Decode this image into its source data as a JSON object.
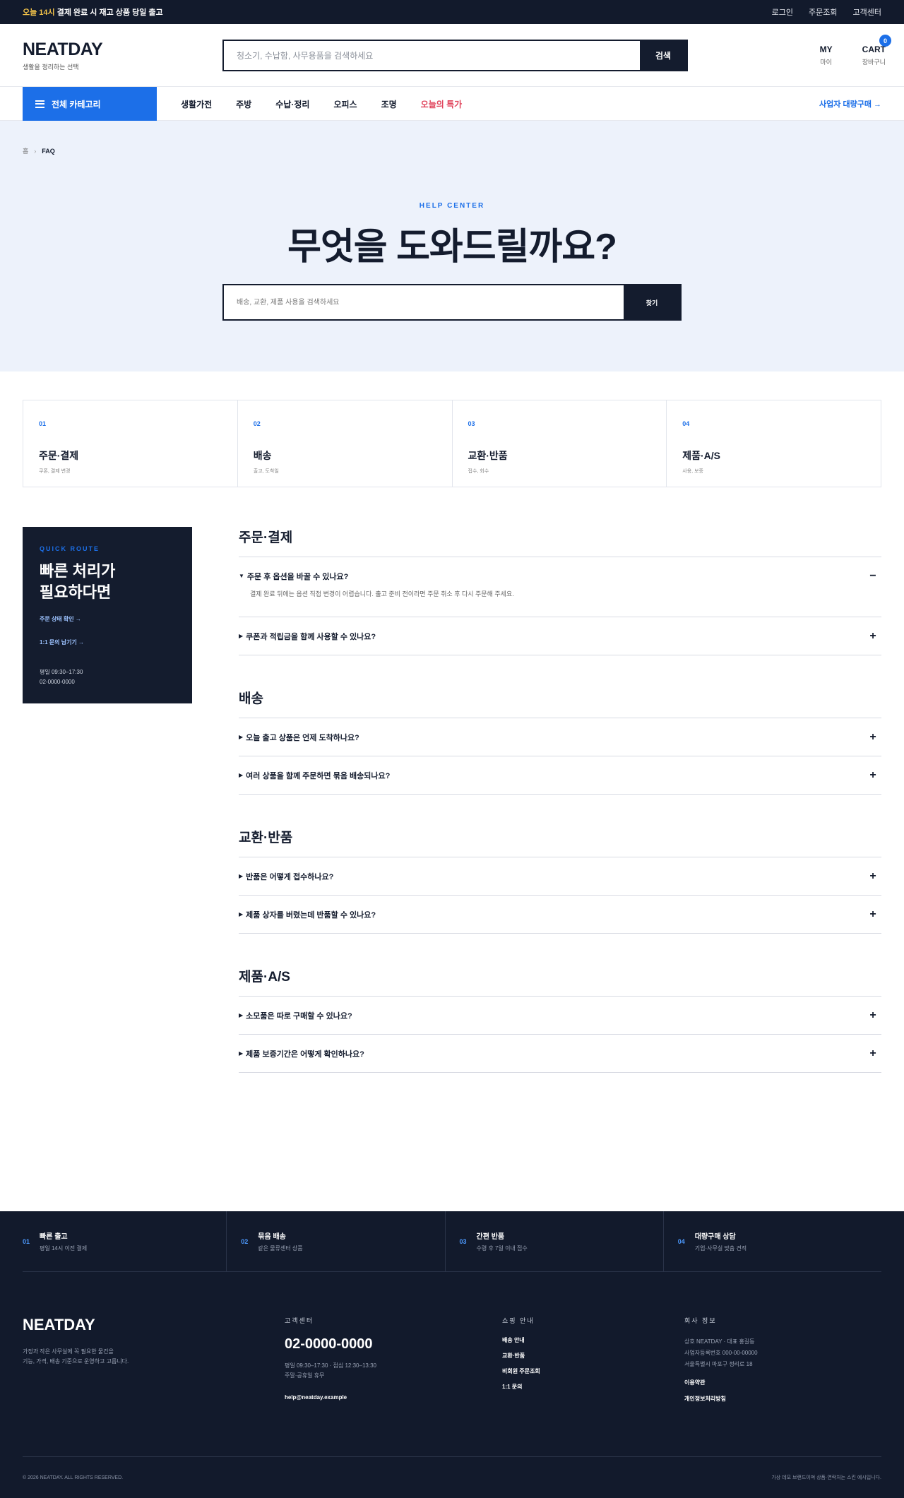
{
  "topbar": {
    "highlight": "오늘 14시",
    "notice": " 결제 완료 시 재고 상품 당일 출고",
    "links": [
      "로그인",
      "주문조회",
      "고객센터"
    ]
  },
  "header": {
    "logo": "NEATDAY",
    "tagline": "생활을 정리하는 선택",
    "search_placeholder": "청소기, 수납함, 사무용품을 검색하세요",
    "search_button": "검색",
    "my_label": "MY",
    "my_sub": "마이",
    "cart_label": "CART",
    "cart_sub": "장바구니",
    "cart_count": "0"
  },
  "nav": {
    "category_button": "전체 카테고리",
    "items": [
      "생활가전",
      "주방",
      "수납·정리",
      "오피스",
      "조명"
    ],
    "sale_item": "오늘의 특가",
    "bulk_link": "사업자 대량구매 →"
  },
  "breadcrumb": {
    "home": "홈",
    "sep": "›",
    "current": "FAQ"
  },
  "hero": {
    "eyebrow": "HELP CENTER",
    "title": "무엇을 도와드릴까요?",
    "search_placeholder": "배송, 교환, 제품 사용을 검색하세요",
    "search_button": "찾기"
  },
  "categories": [
    {
      "num": "01",
      "title": "주문·결제",
      "sub": "쿠폰, 결제 변경"
    },
    {
      "num": "02",
      "title": "배송",
      "sub": "출고, 도착일"
    },
    {
      "num": "03",
      "title": "교환·반품",
      "sub": "접수, 회수"
    },
    {
      "num": "04",
      "title": "제품·A/S",
      "sub": "사용, 보증"
    }
  ],
  "quick": {
    "eyebrow": "QUICK ROUTE",
    "title_line1": "빠른 처리가",
    "title_line2": "필요하다면",
    "link1": "주문 상태 확인 →",
    "link2": "1:1 문의 남기기 →",
    "hours": "평일 09:30–17:30",
    "phone": "02-0000-0000"
  },
  "faq": [
    {
      "title": "주문·결제",
      "items": [
        {
          "q": "주문 후 옵션을 바꿀 수 있나요?",
          "open": true,
          "a": "결제 완료 뒤에는 옵션 직접 변경이 어렵습니다. 출고 준비 전이라면 주문 취소 후 다시 주문해 주세요."
        },
        {
          "q": "쿠폰과 적립금을 함께 사용할 수 있나요?",
          "open": false
        }
      ]
    },
    {
      "title": "배송",
      "items": [
        {
          "q": "오늘 출고 상품은 언제 도착하나요?",
          "open": false
        },
        {
          "q": "여러 상품을 함께 주문하면 묶음 배송되나요?",
          "open": false
        }
      ]
    },
    {
      "title": "교환·반품",
      "items": [
        {
          "q": "반품은 어떻게 접수하나요?",
          "open": false
        },
        {
          "q": "제품 상자를 버렸는데 반품할 수 있나요?",
          "open": false
        }
      ]
    },
    {
      "title": "제품·A/S",
      "items": [
        {
          "q": "소모품은 따로 구매할 수 있나요?",
          "open": false
        },
        {
          "q": "제품 보증기간은 어떻게 확인하나요?",
          "open": false
        }
      ]
    }
  ],
  "features": [
    {
      "num": "01",
      "title": "빠른 출고",
      "sub": "평일 14시 이전 결제"
    },
    {
      "num": "02",
      "title": "묶음 배송",
      "sub": "같은 물류센터 상품"
    },
    {
      "num": "03",
      "title": "간편 반품",
      "sub": "수령 후 7일 이내 접수"
    },
    {
      "num": "04",
      "title": "대량구매 상담",
      "sub": "기업·사무실 맞춤 견적"
    }
  ],
  "footer": {
    "logo": "NEATDAY",
    "desc_line1": "가정과 작은 사무실에 꼭 필요한 물건을",
    "desc_line2": "기능, 가격, 배송 기준으로 운영하고 고릅니다.",
    "cs_heading": "고객센터",
    "cs_phone": "02-0000-0000",
    "cs_hours": "평일 09:30–17:30 · 점심 12:30–13:30",
    "cs_closed": "주말·공휴일 휴무",
    "cs_email": "help@neatday.example",
    "guide_heading": "쇼핑 안내",
    "guide_links": [
      "배송 안내",
      "교환·반품",
      "비회원 주문조회",
      "1:1 문의"
    ],
    "company_heading": "회사 정보",
    "company_line1": "상호 NEATDAY · 대표 홍길동",
    "company_line2": "사업자등록번호 000-00-00000",
    "company_line3": "서울특별시 마포구 정리로 18",
    "terms": "이용약관",
    "privacy": "개인정보처리방침",
    "copyright": "© 2026 NEATDAY. ALL RIGHTS RESERVED.",
    "disclaimer": "가상 데모 브랜드이며 상품·연락처는 스킨 예시입니다."
  },
  "colors": {
    "navy": "#141c2e",
    "accent": "#1c6fe8",
    "sale": "#e0435b",
    "highlight": "#f3c34a",
    "hero_bg": "#edf2fb"
  }
}
